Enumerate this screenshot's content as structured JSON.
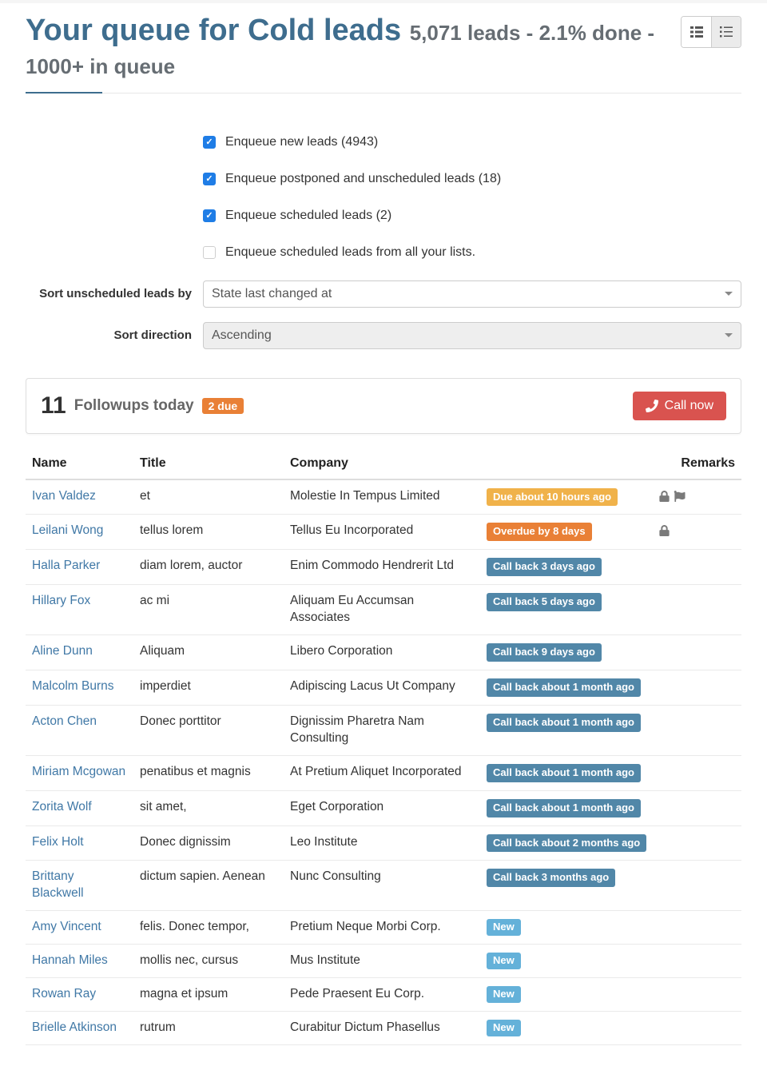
{
  "header": {
    "title_prefix": "Your queue for ",
    "title_name": "Cold leads",
    "subtitle": "5,071 leads - 2.1% done - 1000+ in queue"
  },
  "checkboxes": [
    {
      "label": "Enqueue new leads (4943)",
      "checked": true
    },
    {
      "label": "Enqueue postponed and unscheduled leads (18)",
      "checked": true
    },
    {
      "label": "Enqueue scheduled leads (2)",
      "checked": true
    },
    {
      "label": "Enqueue scheduled leads from all your lists.",
      "checked": false
    }
  ],
  "sort": {
    "unscheduled_label": "Sort unscheduled leads by",
    "unscheduled_value": "State last changed at",
    "direction_label": "Sort direction",
    "direction_value": "Ascending"
  },
  "followups": {
    "count": "11",
    "text": "Followups today",
    "due_badge": "2 due",
    "call_now": "Call now"
  },
  "table": {
    "headers": {
      "name": "Name",
      "title": "Title",
      "company": "Company",
      "remarks": "Remarks"
    },
    "rows": [
      {
        "name": "Ivan Valdez",
        "title": "et",
        "company": "Molestie In Tempus Limited",
        "status_text": "Due about 10 hours ago",
        "status_kind": "due",
        "lock": true,
        "flag": true
      },
      {
        "name": "Leilani Wong",
        "title": "tellus lorem",
        "company": "Tellus Eu Incorporated",
        "status_text": "Overdue by 8 days",
        "status_kind": "overdue",
        "lock": true,
        "flag": false
      },
      {
        "name": "Halla Parker",
        "title": "diam lorem, auctor",
        "company": "Enim Commodo Hendrerit Ltd",
        "status_text": "Call back 3 days ago",
        "status_kind": "callback",
        "lock": false,
        "flag": false
      },
      {
        "name": "Hillary Fox",
        "title": "ac mi",
        "company": "Aliquam Eu Accumsan Associates",
        "status_text": "Call back 5 days ago",
        "status_kind": "callback",
        "lock": false,
        "flag": false
      },
      {
        "name": "Aline Dunn",
        "title": "Aliquam",
        "company": "Libero Corporation",
        "status_text": "Call back 9 days ago",
        "status_kind": "callback",
        "lock": false,
        "flag": false
      },
      {
        "name": "Malcolm Burns",
        "title": "imperdiet",
        "company": "Adipiscing Lacus Ut Company",
        "status_text": "Call back about 1 month ago",
        "status_kind": "callback",
        "lock": false,
        "flag": false
      },
      {
        "name": "Acton Chen",
        "title": "Donec porttitor",
        "company": "Dignissim Pharetra Nam Consulting",
        "status_text": "Call back about 1 month ago",
        "status_kind": "callback",
        "lock": false,
        "flag": false
      },
      {
        "name": "Miriam Mcgowan",
        "title": "penatibus et magnis",
        "company": "At Pretium Aliquet Incorporated",
        "status_text": "Call back about 1 month ago",
        "status_kind": "callback",
        "lock": false,
        "flag": false
      },
      {
        "name": "Zorita Wolf",
        "title": "sit amet,",
        "company": "Eget Corporation",
        "status_text": "Call back about 1 month ago",
        "status_kind": "callback",
        "lock": false,
        "flag": false
      },
      {
        "name": "Felix Holt",
        "title": "Donec dignissim",
        "company": "Leo Institute",
        "status_text": "Call back about 2 months ago",
        "status_kind": "callback",
        "lock": false,
        "flag": false
      },
      {
        "name": "Brittany Blackwell",
        "title": "dictum sapien. Aenean",
        "company": "Nunc Consulting",
        "status_text": "Call back 3 months ago",
        "status_kind": "callback",
        "lock": false,
        "flag": false
      },
      {
        "name": "Amy Vincent",
        "title": "felis. Donec tempor,",
        "company": "Pretium Neque Morbi Corp.",
        "status_text": "New",
        "status_kind": "new",
        "lock": false,
        "flag": false
      },
      {
        "name": "Hannah Miles",
        "title": "mollis nec, cursus",
        "company": "Mus Institute",
        "status_text": "New",
        "status_kind": "new",
        "lock": false,
        "flag": false
      },
      {
        "name": "Rowan Ray",
        "title": "magna et ipsum",
        "company": "Pede Praesent Eu Corp.",
        "status_text": "New",
        "status_kind": "new",
        "lock": false,
        "flag": false
      },
      {
        "name": "Brielle Atkinson",
        "title": "rutrum",
        "company": "Curabitur Dictum Phasellus",
        "status_text": "New",
        "status_kind": "new",
        "lock": false,
        "flag": false
      }
    ]
  }
}
